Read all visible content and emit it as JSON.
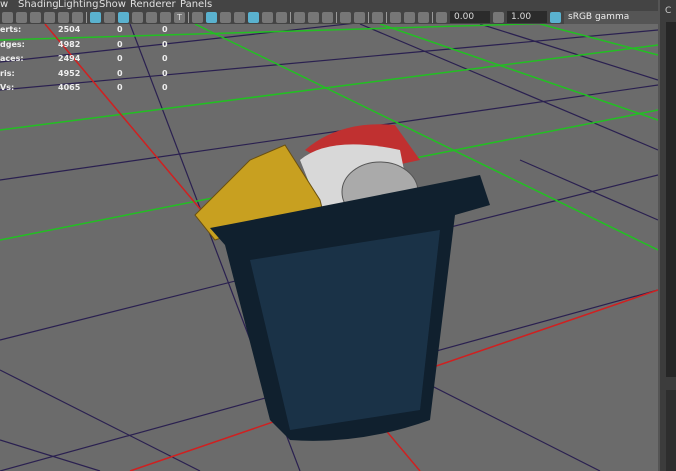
{
  "menu": [
    "w",
    "Shading",
    "Lighting",
    "Show",
    "Renderer",
    "Panels"
  ],
  "toolbar": {
    "exposure": "0.00",
    "gamma": "1.00",
    "color_space": "sRGB gamma"
  },
  "stats": [
    {
      "label": "erts:",
      "values": [
        "2504",
        "0",
        "0"
      ]
    },
    {
      "label": "dges:",
      "values": [
        "4982",
        "0",
        "0"
      ]
    },
    {
      "label": "aces:",
      "values": [
        "2494",
        "0",
        "0"
      ]
    },
    {
      "label": "ris:",
      "values": [
        "4952",
        "0",
        "0"
      ]
    },
    {
      "label": "Vs:",
      "values": [
        "4065",
        "0",
        "0"
      ]
    }
  ],
  "right_panel": {
    "label": "C"
  },
  "colors": {
    "grid_x": "#d02020",
    "grid_z": "#22c022",
    "grid": "#2a2050",
    "accent": "#5ab2cf"
  }
}
